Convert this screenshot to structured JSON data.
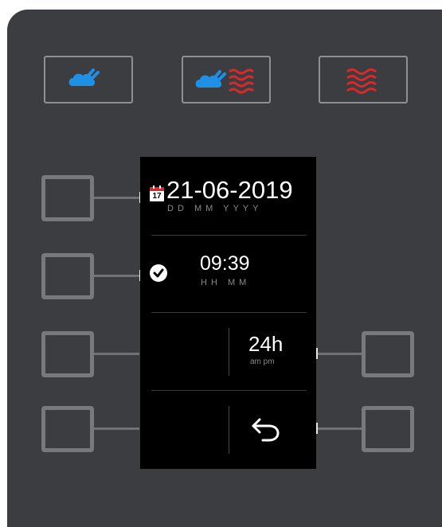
{
  "modes": [
    {
      "name": "steam-mode-button",
      "icon": "steam-icon"
    },
    {
      "name": "combi-mode-button",
      "icon": "combi-steam-heat-icon"
    },
    {
      "name": "heat-mode-button",
      "icon": "hot-air-icon"
    }
  ],
  "screen": {
    "date": {
      "value": "21-06-2019",
      "format": "DD  MM  YYYY",
      "icon": "calendar-icon",
      "icon_day": "17"
    },
    "time": {
      "value": "09:39",
      "format": "HH  MM",
      "icon": "clock-check-icon"
    },
    "clock_mode": {
      "value": "24h",
      "subtitle": "am pm"
    },
    "back": {
      "icon": "return-arrow-icon"
    }
  },
  "colors": {
    "steam": "#1e90e6",
    "heat": "#d82a2a",
    "panel": "#3c3d40",
    "screen": "#000000"
  }
}
